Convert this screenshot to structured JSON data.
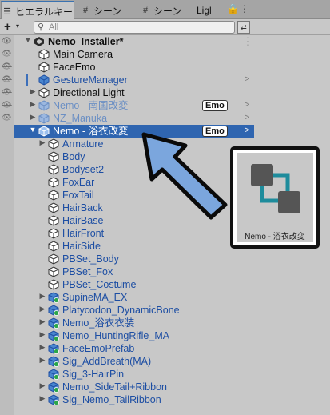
{
  "tabs": [
    {
      "label": "ヒエラルキー",
      "icon": "list-icon"
    },
    {
      "label": "シーン",
      "icon": "grid-icon"
    },
    {
      "label": "シーン",
      "icon": "grid-icon"
    },
    {
      "label": "Ligl",
      "icon": ""
    }
  ],
  "window_buttons": {
    "lock": "🔒",
    "menu": "⋮"
  },
  "toolbar": {
    "add": "+",
    "add_caret": "▾",
    "search_placeholder": "All",
    "search_value": ""
  },
  "scene": {
    "name": "Nemo_Installer*"
  },
  "rows": [
    {
      "label": "Main Camera",
      "style": "normal"
    },
    {
      "label": "FaceEmo",
      "style": "normal"
    },
    {
      "label": "GestureManager",
      "style": "blue",
      "chevron": ">"
    },
    {
      "label": "Directional Light",
      "style": "normal",
      "expand": "▶"
    },
    {
      "label": "Nemo - 南国改変",
      "style": "dim",
      "expand": "▶",
      "badge": "Emo",
      "chevron": ">"
    },
    {
      "label": "NZ_Manuka",
      "style": "dim",
      "expand": "▶",
      "chevron": ">"
    },
    {
      "label": "Nemo - 浴衣改変",
      "style": "selected",
      "expand": "▼",
      "badge": "Emo",
      "chevron": ">"
    },
    {
      "label": "Armature",
      "style": "blue",
      "expand": "▶"
    },
    {
      "label": "Body",
      "style": "blue"
    },
    {
      "label": "Bodyset2",
      "style": "blue"
    },
    {
      "label": "FoxEar",
      "style": "blue"
    },
    {
      "label": "FoxTail",
      "style": "blue"
    },
    {
      "label": "HairBack",
      "style": "blue"
    },
    {
      "label": "HairBase",
      "style": "blue"
    },
    {
      "label": "HairFront",
      "style": "blue"
    },
    {
      "label": "HairSide",
      "style": "blue"
    },
    {
      "label": "PBSet_Body",
      "style": "blue"
    },
    {
      "label": "PBSet_Fox",
      "style": "blue"
    },
    {
      "label": "PBSet_Costume",
      "style": "blue"
    },
    {
      "label": "SupineMA_EX",
      "style": "blue",
      "expand": "▶"
    },
    {
      "label": "Platycodon_DynamicBone",
      "style": "blue",
      "expand": "▶"
    },
    {
      "label": "Nemo_浴衣衣装",
      "style": "blue",
      "expand": "▶"
    },
    {
      "label": "Nemo_HuntingRifle_MA",
      "style": "blue",
      "expand": "▶"
    },
    {
      "label": "FaceEmoPrefab",
      "style": "blue",
      "expand": "▶"
    },
    {
      "label": "Sig_AddBreath(MA)",
      "style": "blue",
      "expand": "▶"
    },
    {
      "label": "Sig_3-HairPin",
      "style": "blue"
    },
    {
      "label": "Nemo_SideTail+Ribbon",
      "style": "blue",
      "expand": "▶"
    },
    {
      "label": "Sig_Nemo_TailRibbon",
      "style": "blue",
      "expand": "▶"
    }
  ],
  "callout": {
    "label": "Nemo - 浴衣改変"
  },
  "colors": {
    "selection": "#2f65b0",
    "prefab_text": "#1d4ea3",
    "arrow_fill": "#7ba6dd"
  }
}
